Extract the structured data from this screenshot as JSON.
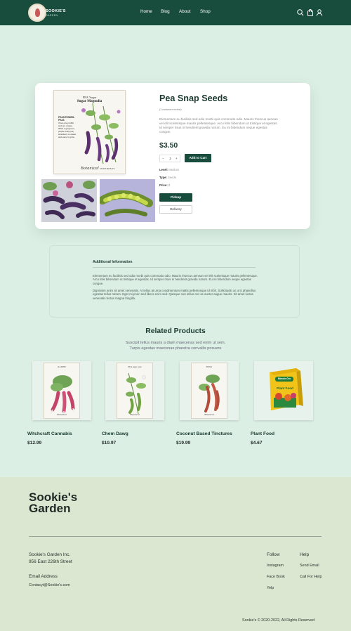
{
  "header": {
    "logo_text": "SOOKIE'S",
    "logo_sub": "GARDEN",
    "nav": [
      "Home",
      "Blog",
      "About",
      "Shop"
    ],
    "icons": [
      "search-icon",
      "cart-icon",
      "user-icon"
    ],
    "bg_color": "#184d3e"
  },
  "product": {
    "packet": {
      "line1": "PEA 'Sugar",
      "line2": "Sugar Magnolia",
      "heading": "PEAS/TENDRIL PEAS",
      "desc": "Vines are prolific and are unique. What a gorgeous, purple snap pea, stranded, so sweet and easy to grow.",
      "footer": "Botanical",
      "footer_small": "INTERESTS"
    },
    "title": "Pea Snap Seeds",
    "reviews": "(1 customer review)",
    "description": "Elementum eu facilisis sed odio morbi quis commodo odio. Mauris rhoncus aenean vel elit scelerisque mauris pellentesque. Arcu felis bibendum ut tristique et egestas. Id semper risus in hendrerit gravida rutrum. Eu mi bibendum neque egestas congue.",
    "price": "$3.50",
    "quantity": "1",
    "minus": "−",
    "plus": "+",
    "add_to_cart": "Add to Cart",
    "level_label": "Level:",
    "level_value": "Medium",
    "type_label": "Type:",
    "type_value": "Seeds",
    "price_label": "Price:",
    "price_value": "$",
    "pickup": "Pickup",
    "delivery": "Delivery"
  },
  "info": {
    "title": "Additional Information",
    "p1": "Elementum eu facilisis sed odio morbi quis commodo odio. Mauris rhoncus aenean vel elit scelerisque mauris pellentesque. Arcu felis bibendum ut tristique et egestas. Id semper risus in hendrerit gravida rutrum. Eu mi bibendum neque egestas congue.",
    "p2": "Dignissim enim sit amet venenatis. At tellus at urna condimentum mattis pellentesque id nibh. Sollicitudin ac orci phasellus egestas tellus rutrum. Eget mi proin sed libero enim sed. Quisque non tellus orci ac auctor augue mauris. Sit amet luctus venenatis lectus magna fringilla."
  },
  "related": {
    "title": "Related Products",
    "subtitle_1": "Suscipit tellus mauris a diam maecenas sed enim ut sem.",
    "subtitle_2": "Turpis egestas maecenas pharetra convallis posuere",
    "items": [
      {
        "name": "Witchcraft Cannabis",
        "price": "$12.99",
        "packet_title": "RADISH",
        "packet_footer": "Botanical"
      },
      {
        "name": "Chem Dawg",
        "price": "$10.97",
        "packet_title": "PEA sugar snap",
        "packet_footer": "Botanical"
      },
      {
        "name": "Coconut Based Tinctures",
        "price": "$19.99",
        "packet_title": "BEAN",
        "packet_footer": "Botanical"
      },
      {
        "name": "Plant Food",
        "price": "$4.67",
        "box_brand": "Miracle-Gro",
        "box_title": "Plant Food"
      }
    ]
  },
  "footer": {
    "brand_line1": "Sookie's",
    "brand_line2": "Garden",
    "company": "Sookie's Garden Inc.",
    "address": "956 East 226th Street",
    "email_label": "Email Address",
    "email": "Contacyt@Sookie's.com",
    "follow_title": "Follow",
    "follow": [
      "Instagram",
      "Face Book",
      "Yelp"
    ],
    "help_title": "Help",
    "help": [
      "Send Email",
      "Call For Help"
    ],
    "copyright": "Sookie's © 2020-2022, All Rights Reserved",
    "bg_color": "#dbe7d0"
  }
}
